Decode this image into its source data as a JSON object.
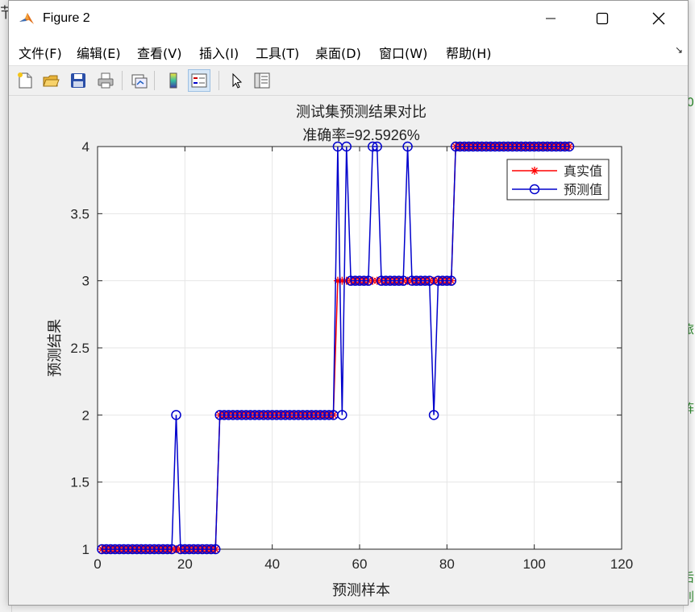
{
  "window": {
    "title": "Figure 2"
  },
  "menu": [
    "文件(F)",
    "编辑(E)",
    "查看(V)",
    "插入(I)",
    "工具(T)",
    "桌面(D)",
    "窗口(W)",
    "帮助(H)"
  ],
  "toolbar": {
    "icons": [
      "new-figure-icon",
      "open-file-icon",
      "save-icon",
      "print-icon",
      "link-plot-icon",
      "colorbar-icon",
      "legend-icon",
      "pointer-icon",
      "property-editor-icon"
    ]
  },
  "background": {
    "top_left_char": "节",
    "right_chars": [
      "0",
      "旅",
      "、",
      "訁",
      "阵",
      "后",
      "别"
    ]
  },
  "colors": {
    "true_series": "#ff0000",
    "pred_series": "#0000cc",
    "grid": "#e6e6e6"
  },
  "chart_data": {
    "type": "line",
    "title": "测试集预测结果对比",
    "subtitle": "准确率=92.5926%",
    "xlabel": "预测样本",
    "ylabel": "预测结果",
    "xlim": [
      0,
      120
    ],
    "ylim": [
      1,
      4
    ],
    "xticks": [
      "0",
      "20",
      "40",
      "60",
      "80",
      "100",
      "120"
    ],
    "yticks": [
      "1",
      "1.5",
      "2",
      "2.5",
      "3",
      "3.5",
      "4"
    ],
    "grid": true,
    "legend_location": "top-right",
    "series": [
      {
        "name": "真实值",
        "marker": "*",
        "color": "#ff0000",
        "values": [
          1,
          1,
          1,
          1,
          1,
          1,
          1,
          1,
          1,
          1,
          1,
          1,
          1,
          1,
          1,
          1,
          1,
          1,
          1,
          1,
          1,
          1,
          1,
          1,
          1,
          1,
          1,
          2,
          2,
          2,
          2,
          2,
          2,
          2,
          2,
          2,
          2,
          2,
          2,
          2,
          2,
          2,
          2,
          2,
          2,
          2,
          2,
          2,
          2,
          2,
          2,
          2,
          2,
          2,
          3,
          3,
          3,
          3,
          3,
          3,
          3,
          3,
          3,
          3,
          3,
          3,
          3,
          3,
          3,
          3,
          3,
          3,
          3,
          3,
          3,
          3,
          3,
          3,
          3,
          3,
          3,
          4,
          4,
          4,
          4,
          4,
          4,
          4,
          4,
          4,
          4,
          4,
          4,
          4,
          4,
          4,
          4,
          4,
          4,
          4,
          4,
          4,
          4,
          4,
          4,
          4,
          4,
          4
        ]
      },
      {
        "name": "预测值",
        "marker": "o",
        "color": "#0000cc",
        "values": [
          1,
          1,
          1,
          1,
          1,
          1,
          1,
          1,
          1,
          1,
          1,
          1,
          1,
          1,
          1,
          1,
          1,
          2,
          1,
          1,
          1,
          1,
          1,
          1,
          1,
          1,
          1,
          2,
          2,
          2,
          2,
          2,
          2,
          2,
          2,
          2,
          2,
          2,
          2,
          2,
          2,
          2,
          2,
          2,
          2,
          2,
          2,
          2,
          2,
          2,
          2,
          2,
          2,
          2,
          4,
          2,
          4,
          3,
          3,
          3,
          3,
          3,
          4,
          4,
          3,
          3,
          3,
          3,
          3,
          3,
          4,
          3,
          3,
          3,
          3,
          3,
          2,
          3,
          3,
          3,
          3,
          4,
          4,
          4,
          4,
          4,
          4,
          4,
          4,
          4,
          4,
          4,
          4,
          4,
          4,
          4,
          4,
          4,
          4,
          4,
          4,
          4,
          4,
          4,
          4,
          4,
          4,
          4
        ]
      }
    ]
  }
}
